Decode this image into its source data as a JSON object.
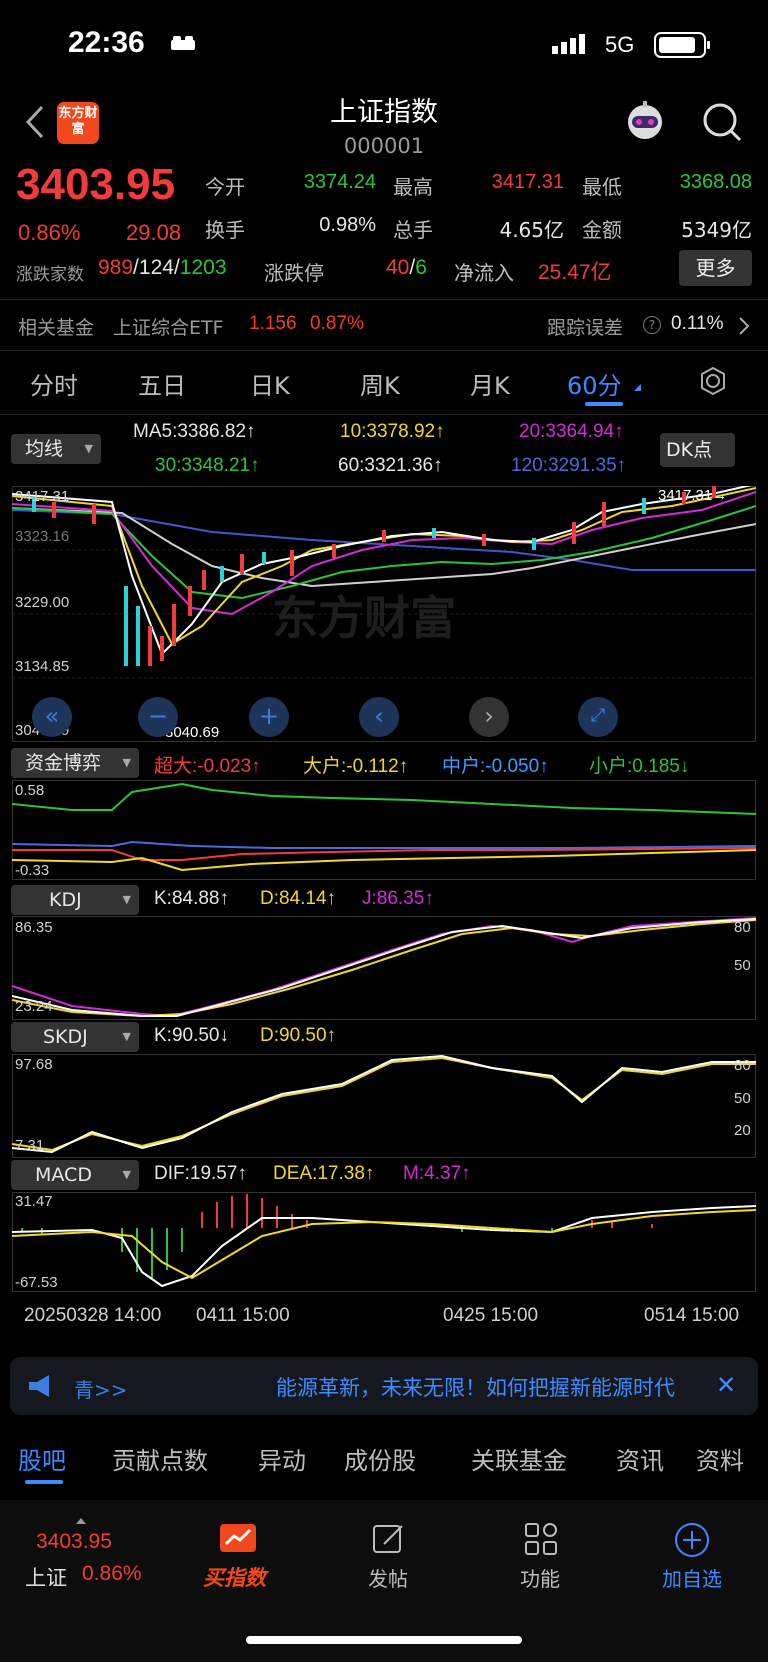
{
  "status": {
    "time": "22:36",
    "network": "5G"
  },
  "header": {
    "title": "上证指数",
    "code": "000001",
    "logo_text": "东方财富"
  },
  "quote": {
    "price": "3403.95",
    "change_pct": "0.86%",
    "change": "29.08",
    "open_label": "今开",
    "open": "3374.24",
    "high_label": "最高",
    "high": "3417.31",
    "low_label": "最低",
    "low": "3368.08",
    "turnover_label": "换手",
    "turnover": "0.98%",
    "volume_label": "总手",
    "volume": "4.65亿",
    "amount_label": "金额",
    "amount": "5349亿",
    "breadth_label": "涨跌家数",
    "up_count": "989",
    "flat_count": "124",
    "down_count": "1203",
    "limit_label": "涨跌停",
    "limit_up": "40",
    "limit_down": "6",
    "inflow_label": "净流入",
    "inflow": "25.47亿",
    "more_label": "更多"
  },
  "fund": {
    "label": "相关基金",
    "name": "上证综合ETF",
    "price": "1.156",
    "pct": "0.87%",
    "track_label": "跟踪误差",
    "track_value": "0.11%"
  },
  "tabs": [
    "分时",
    "五日",
    "日K",
    "周K",
    "月K",
    "60分"
  ],
  "active_tab": 5,
  "ma": {
    "selector": "均线",
    "ma5": "MA5:3386.82↑",
    "ma10": "10:3378.92↑",
    "ma20": "20:3364.94↑",
    "ma30": "30:3348.21↑",
    "ma60": "60:3321.36↑",
    "ma120": "120:3291.35↑",
    "dk_label": "DK点"
  },
  "price_chart": {
    "y_labels": [
      "3417.31",
      "3323.16",
      "3229.00",
      "3134.85",
      "3040.69"
    ],
    "high_marker": "3417.31→",
    "low_marker": "←3040.69",
    "watermark": "东方财富"
  },
  "fund_flow": {
    "selector": "资金博弈",
    "super": "超大:-0.023↑",
    "big": "大户:-0.112↑",
    "mid": "中户:-0.050↑",
    "small": "小户:0.185↓",
    "y_top": "0.58",
    "y_bottom": "-0.33"
  },
  "kdj": {
    "selector": "KDJ",
    "k": "K:84.88↑",
    "d": "D:84.14↑",
    "j": "J:86.35↑",
    "y_top": "86.35",
    "y_bottom": "23.24",
    "r80": "80",
    "r50": "50"
  },
  "skdj": {
    "selector": "SKDJ",
    "k": "K:90.50↓",
    "d": "D:90.50↑",
    "y_top": "97.68",
    "y_bottom": "7.31",
    "r80": "80",
    "r50": "50",
    "r20": "20"
  },
  "macd": {
    "selector": "MACD",
    "dif": "DIF:19.57↑",
    "dea": "DEA:17.38↑",
    "m": "M:4.37↑",
    "y_top": "31.47",
    "y_bottom": "-67.53"
  },
  "x_axis": [
    "20250328 14:00",
    "0411 15:00",
    "0425 15:00",
    "0514 15:00"
  ],
  "banner": {
    "prefix": "青>>",
    "text": "能源革新，未来无限！如何把握新能源时代"
  },
  "bottom_tabs": [
    "股吧",
    "贡献点数",
    "异动",
    "成份股",
    "关联基金",
    "资讯",
    "资料"
  ],
  "nav": {
    "index_price": "3403.95",
    "index_name": "上证",
    "index_pct": "0.86%",
    "buy": "买指数",
    "post": "发帖",
    "func": "功能",
    "add": "加自选"
  }
}
